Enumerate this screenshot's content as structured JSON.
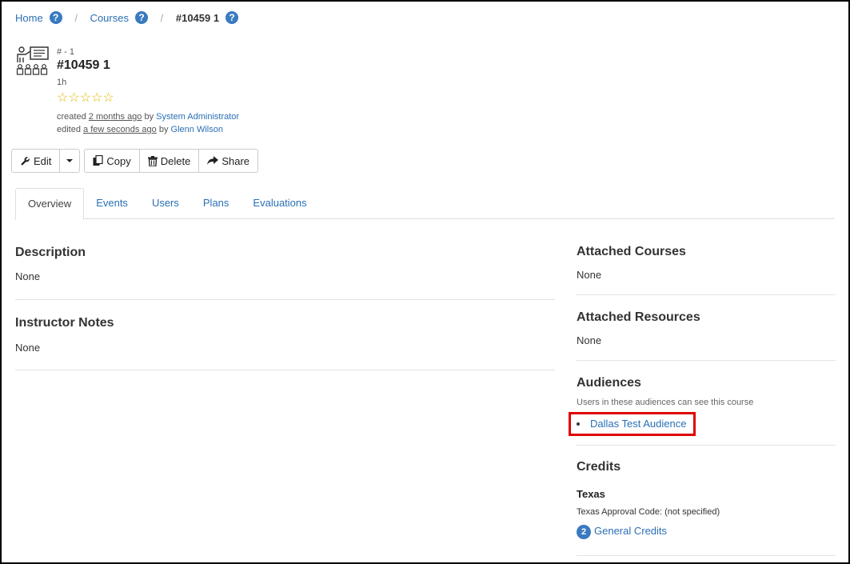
{
  "breadcrumb": {
    "home": "Home",
    "courses": "Courses",
    "current": "#10459 1",
    "help": "?"
  },
  "course": {
    "number": "# - 1",
    "title": "#10459 1",
    "duration": "1h",
    "stars": "☆☆☆☆☆",
    "created_prefix": "created",
    "created_when": "2 months ago",
    "created_by_prefix": "by",
    "created_by": "System Administrator",
    "edited_prefix": "edited",
    "edited_when": "a few seconds ago",
    "edited_by_prefix": "by",
    "edited_by": "Glenn Wilson"
  },
  "toolbar": {
    "edit": "Edit",
    "copy": "Copy",
    "delete": "Delete",
    "share": "Share"
  },
  "tabs": [
    "Overview",
    "Events",
    "Users",
    "Plans",
    "Evaluations"
  ],
  "left": {
    "description_title": "Description",
    "description_value": "None",
    "notes_title": "Instructor Notes",
    "notes_value": "None"
  },
  "right": {
    "attached_courses_title": "Attached Courses",
    "attached_courses_value": "None",
    "attached_resources_title": "Attached Resources",
    "attached_resources_value": "None",
    "audiences_title": "Audiences",
    "audiences_sub": "Users in these audiences can see this course",
    "audiences": [
      "Dallas Test Audience"
    ],
    "credits_title": "Credits",
    "credits_state": "Texas",
    "credits_code": "Texas Approval Code: (not specified)",
    "credits_count": "2",
    "credits_link": "General Credits"
  },
  "colors": {
    "link": "#2a6fb5",
    "badge": "#3a7abf",
    "highlight": "#e00000",
    "stars": "#e0b800"
  }
}
